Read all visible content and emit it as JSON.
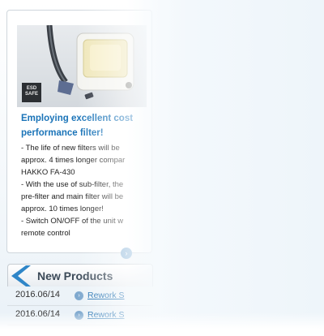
{
  "feature": {
    "badge": "ESD SAFE",
    "title_line1": "Employing excellent cost",
    "title_line2": "performance filter!",
    "body_lines": [
      "- The life of new filters will be",
      "approx. 4 times longer compar",
      "HAKKO FA-430",
      "- With the use of sub-filter, the",
      "pre-filter and main filter will be",
      "approx. 10 times longer!",
      "- Switch ON/OFF of the unit w",
      "remote control"
    ],
    "more_icon": "arrow-right-icon"
  },
  "new_products": {
    "heading": "New Products",
    "items": [
      {
        "date": "2016.06/14",
        "link": "Rework S"
      },
      {
        "date": "2016.06/14",
        "link": "Rework S"
      }
    ]
  },
  "colors": {
    "accent": "#1b74b8",
    "chevron": "#2f86c8"
  }
}
